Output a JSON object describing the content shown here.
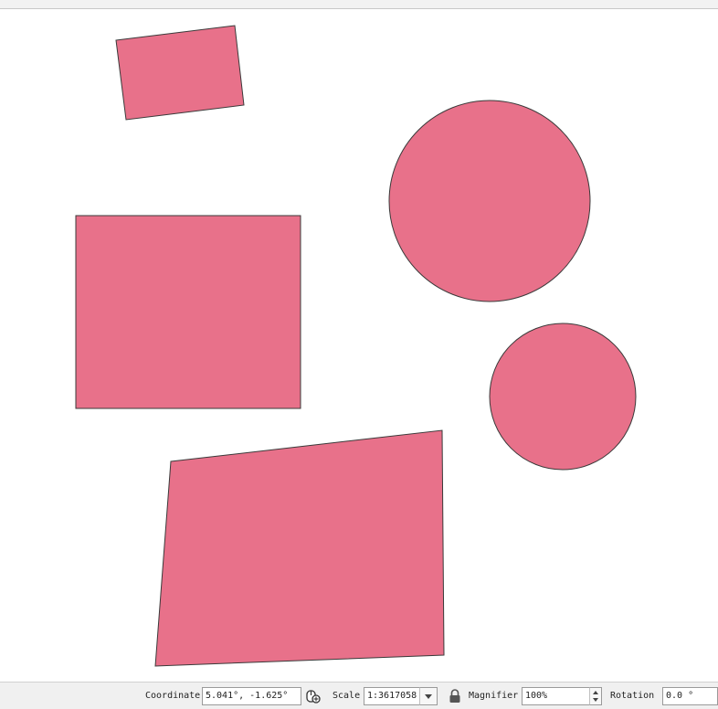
{
  "map": {
    "fill_color": "#e8718a",
    "stroke_color": "#3a3a3a",
    "background_color": "#ffffff",
    "features": [
      {
        "type": "polygon",
        "name": "small-rotated-rectangle"
      },
      {
        "type": "circle",
        "name": "large-circle"
      },
      {
        "type": "polygon",
        "name": "square"
      },
      {
        "type": "circle",
        "name": "small-circle"
      },
      {
        "type": "polygon",
        "name": "quadrilateral"
      }
    ]
  },
  "statusbar": {
    "coordinate_label": "Coordinate",
    "coordinate_value": "5.041°, -1.625°",
    "scale_label": "Scale",
    "scale_value": "1:3617058",
    "magnifier_label": "Magnifier",
    "magnifier_value": "100%",
    "rotation_label": "Rotation",
    "rotation_value": "0.0 °",
    "icons": {
      "extents_toggle": "mouse-extents-icon",
      "scale_lock": "lock-icon"
    }
  }
}
